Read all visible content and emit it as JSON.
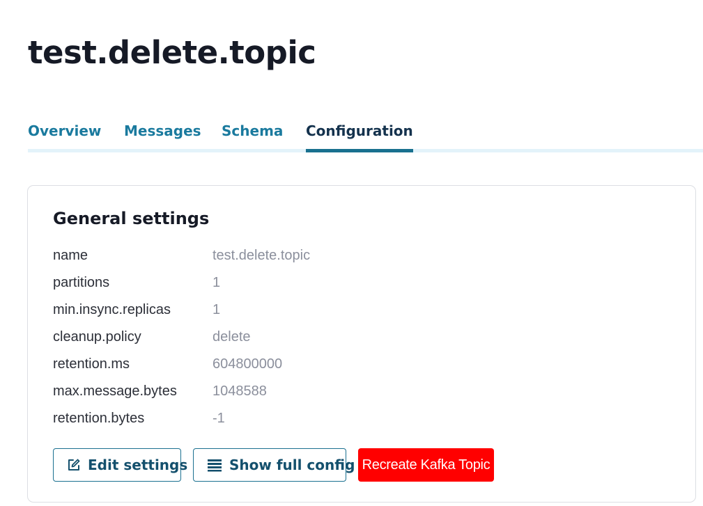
{
  "page": {
    "title": "test.delete.topic"
  },
  "tabs": [
    {
      "label": "Overview",
      "active": false
    },
    {
      "label": "Messages",
      "active": false
    },
    {
      "label": "Schema",
      "active": false
    },
    {
      "label": "Configuration",
      "active": true
    }
  ],
  "general_settings": {
    "title": "General settings",
    "rows": [
      {
        "key": "name",
        "value": "test.delete.topic"
      },
      {
        "key": "partitions",
        "value": "1"
      },
      {
        "key": "min.insync.replicas",
        "value": "1"
      },
      {
        "key": "cleanup.policy",
        "value": "delete"
      },
      {
        "key": "retention.ms",
        "value": "604800000"
      },
      {
        "key": "max.message.bytes",
        "value": "1048588"
      },
      {
        "key": "retention.bytes",
        "value": "-1"
      }
    ]
  },
  "actions": {
    "edit_label": "Edit settings",
    "edit_icon": "edit-icon",
    "full_config_label": "Show full config",
    "full_config_icon": "list-icon",
    "recreate_label": "Recreate Kafka Topic"
  },
  "colors": {
    "accent": "#1a7a9e",
    "active_tab": "#14324d",
    "danger": "#ff0000"
  }
}
